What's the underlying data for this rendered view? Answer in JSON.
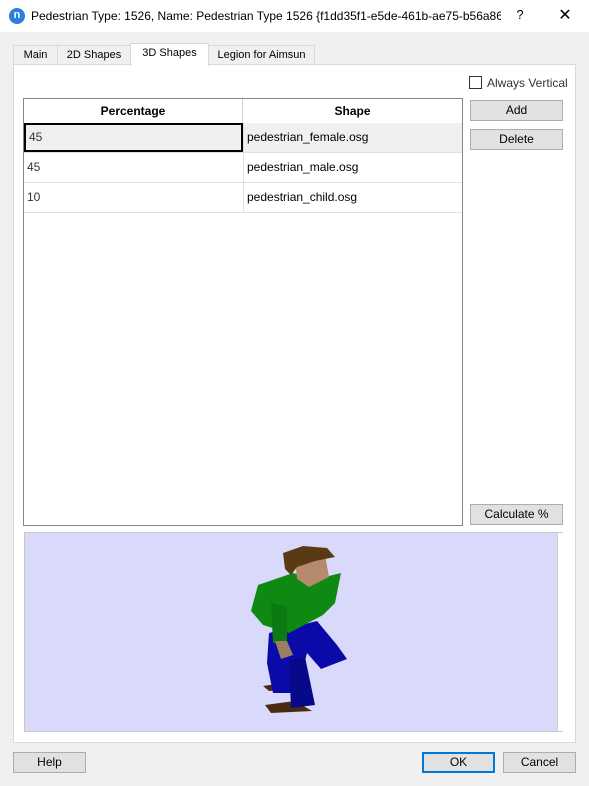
{
  "window": {
    "icon_letter": "n",
    "title": "Pedestrian Type: 1526, Name: Pedestrian Type 1526  {f1dd35f1-e5de-461b-ae75-b56a86...",
    "help_glyph": "?",
    "close_glyph": "✕"
  },
  "tabs": [
    {
      "label": "Main"
    },
    {
      "label": "2D Shapes"
    },
    {
      "label": "3D Shapes"
    },
    {
      "label": "Legion for Aimsun"
    }
  ],
  "active_tab": "3D Shapes",
  "options": {
    "always_vertical_label": "Always Vertical",
    "always_vertical_checked": false
  },
  "table": {
    "columns": [
      "Percentage",
      "Shape"
    ],
    "rows": [
      {
        "percentage": "45",
        "shape": "pedestrian_female.osg"
      },
      {
        "percentage": "45",
        "shape": "pedestrian_male.osg"
      },
      {
        "percentage": "10",
        "shape": "pedestrian_child.osg"
      }
    ],
    "selected_row": 0
  },
  "side_buttons": {
    "add": "Add",
    "delete": "Delete",
    "calculate": "Calculate %"
  },
  "preview": {
    "background": "#d9d9fb",
    "figure_colors": {
      "shirt": "#0e8a12",
      "pants": "#0a0aa8",
      "hair": "#5a3a12",
      "skin": "#b58a6e",
      "shoes": "#4a2a10"
    }
  },
  "footer": {
    "help": "Help",
    "ok": "OK",
    "cancel": "Cancel"
  }
}
